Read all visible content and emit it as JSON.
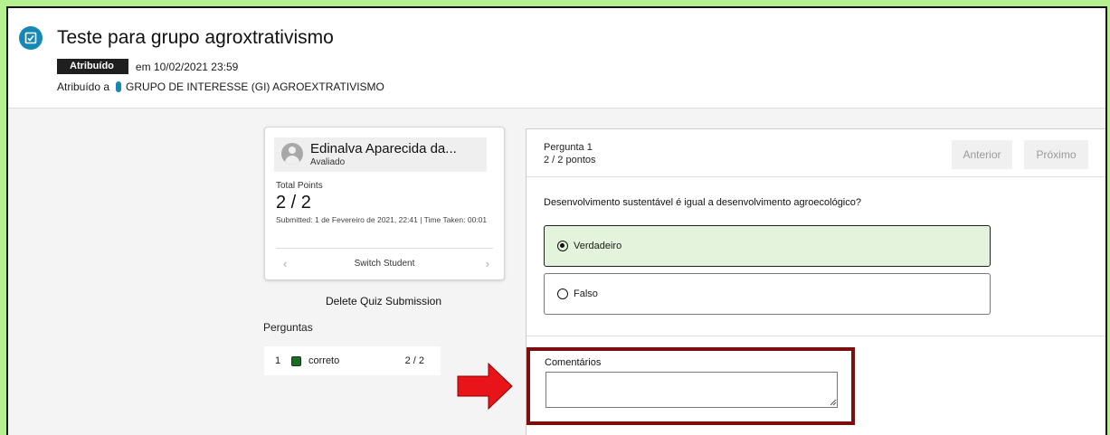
{
  "header": {
    "title": "Teste para grupo agroxtrativismo",
    "status_badge": "Atribuído",
    "assigned_date": "em 10/02/2021 23:59",
    "assigned_prefix": "Atribuído a",
    "assigned_group": "GRUPO DE INTERESSE (GI) AGROEXTRATIVISMO",
    "icon": "assignment-icon"
  },
  "student": {
    "name": "Edinalva Aparecida da...",
    "status": "Avaliado",
    "total_points_label": "Total Points",
    "total_points_value": "2 / 2",
    "submitted_text": "Submitted: 1 de Fevereiro de 2021, 22:41 | Time Taken: 00:01",
    "switch_label": "Switch Student"
  },
  "sidebar": {
    "delete_label": "Delete Quiz Submission",
    "questions_heading": "Perguntas",
    "questions": [
      {
        "number": "1",
        "status": "correto",
        "score": "2 / 2",
        "color": "#1d6b24"
      }
    ]
  },
  "question": {
    "title": "Pergunta 1",
    "points": "2 / 2 pontos",
    "prev_label": "Anterior",
    "next_label": "Próximo",
    "text": "Desenvolvimento sustentável é igual a desenvolvimento agroecológico?",
    "options": [
      {
        "label": "Verdadeiro",
        "selected": true
      },
      {
        "label": "Falso",
        "selected": false
      }
    ],
    "comments_label": "Comentários"
  },
  "colors": {
    "background_highlight": "#b4f090",
    "accent": "#1688b7",
    "annotation_box": "#7b0f0f",
    "annotation_arrow": "#e8141a",
    "selected_answer": "#e4f4dc"
  }
}
